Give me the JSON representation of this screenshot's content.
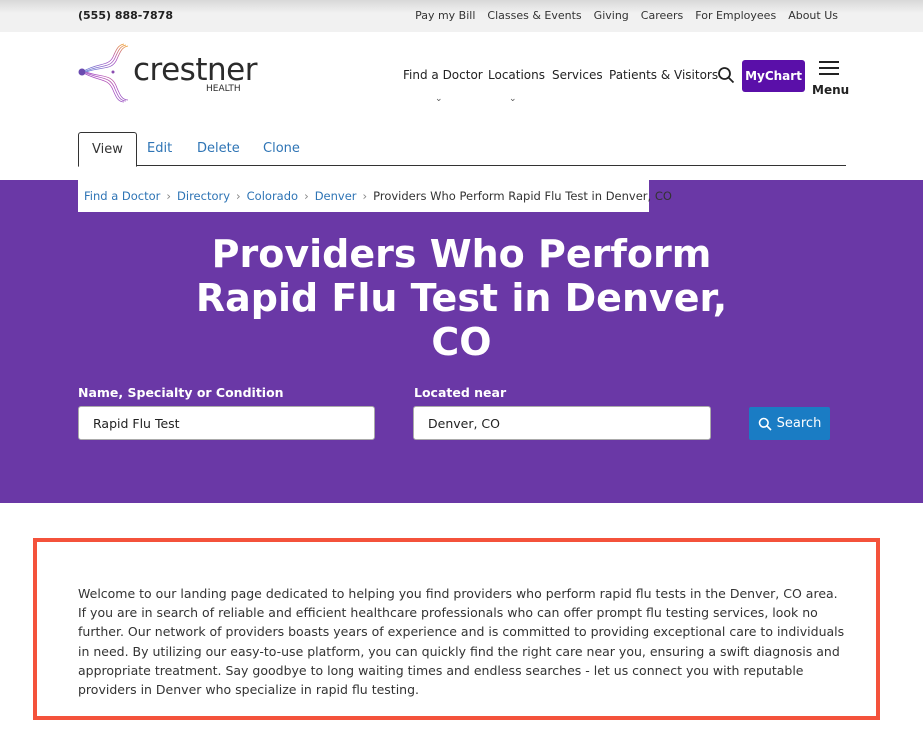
{
  "topbar": {
    "phone": "(555) 888-7878",
    "links": [
      "Pay my Bill",
      "Classes & Events",
      "Giving",
      "Careers",
      "For Employees",
      "About Us"
    ]
  },
  "header": {
    "brand": "crestner",
    "brand_sub": "HEALTH",
    "nav": [
      "Find a Doctor",
      "Locations",
      "Services",
      "Patients & Visitors"
    ],
    "mychart": "MyChart",
    "menu": "Menu"
  },
  "tabs": [
    "View",
    "Edit",
    "Delete",
    "Clone"
  ],
  "breadcrumb": [
    "Find a Doctor",
    "Directory",
    "Colorado",
    "Denver",
    "Providers Who Perform Rapid Flu Test in Denver, CO"
  ],
  "hero": {
    "title": "Providers Who Perform Rapid Flu Test in Denver, CO",
    "name_label": "Name, Specialty or Condition",
    "name_value": "Rapid Flu Test",
    "loc_label": "Located near",
    "loc_value": "Denver, CO",
    "search": "Search"
  },
  "colors": {
    "purple": "#6a38a6",
    "mychart": "#5a0fa9",
    "button": "#1a7cc4",
    "highlight": "#f4523b"
  },
  "content": {
    "intro": "Welcome to our landing page dedicated to helping you find providers who perform rapid flu tests in the Denver, CO area. If you are in search of reliable and efficient healthcare professionals who can offer prompt flu testing services, look no further. Our network of providers boasts years of experience and is committed to providing exceptional care to individuals in need. By utilizing our easy-to-use platform, you can quickly find the right care near you, ensuring a swift diagnosis and appropriate treatment. Say goodbye to long waiting times and endless searches - let us connect you with reputable providers in Denver who specialize in rapid flu testing."
  }
}
